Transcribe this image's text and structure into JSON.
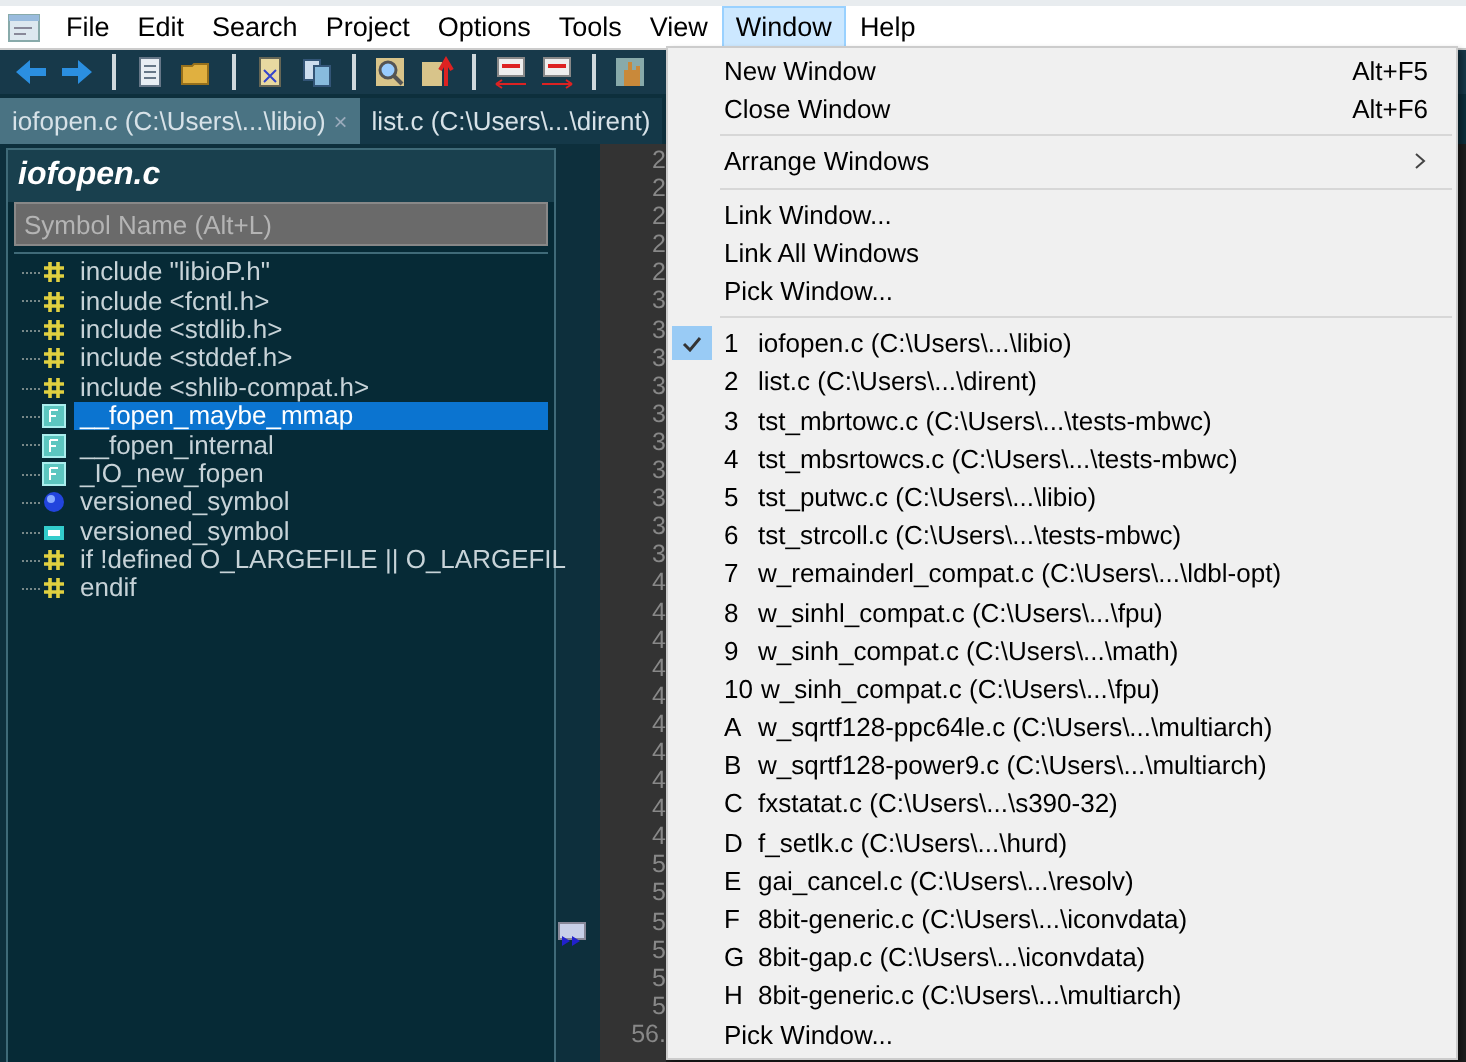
{
  "menubar": [
    {
      "label": "File",
      "selected": false
    },
    {
      "label": "Edit",
      "selected": false
    },
    {
      "label": "Search",
      "selected": false
    },
    {
      "label": "Project",
      "selected": false
    },
    {
      "label": "Options",
      "selected": false
    },
    {
      "label": "Tools",
      "selected": false
    },
    {
      "label": "View",
      "selected": false
    },
    {
      "label": "Window",
      "selected": true
    },
    {
      "label": "Help",
      "selected": false
    }
  ],
  "tabs": [
    {
      "label": "iofopen.c (C:\\Users\\...\\libio)",
      "selected": true,
      "close": "×"
    },
    {
      "label": "list.c (C:\\Users\\...\\dirent)",
      "selected": false
    }
  ],
  "symbol_panel": {
    "title": "iofopen.c",
    "search": {
      "placeholder": "Symbol Name (Alt+L)"
    },
    "items": [
      {
        "kind": "directive",
        "label": "include \"libioP.h\"",
        "selected": false
      },
      {
        "kind": "directive",
        "label": "include <fcntl.h>",
        "selected": false
      },
      {
        "kind": "directive",
        "label": "include <stdlib.h>",
        "selected": false
      },
      {
        "kind": "directive",
        "label": "include <stddef.h>",
        "selected": false
      },
      {
        "kind": "directive",
        "label": "include <shlib-compat.h>",
        "selected": false
      },
      {
        "kind": "function",
        "label": "__fopen_maybe_mmap",
        "selected": true
      },
      {
        "kind": "function",
        "label": "__fopen_internal",
        "selected": false
      },
      {
        "kind": "function",
        "label": "_IO_new_fopen",
        "selected": false
      },
      {
        "kind": "symbol",
        "label": "versioned_symbol",
        "selected": false
      },
      {
        "kind": "declaration",
        "label": "versioned_symbol",
        "selected": false
      },
      {
        "kind": "directive",
        "label": "if !defined O_LARGEFILE || O_LARGEFIL",
        "selected": false
      },
      {
        "kind": "directive",
        "label": "endif",
        "selected": false
      }
    ]
  },
  "gutter": {
    "line_numbers": [
      "2",
      "2",
      "2",
      "2",
      "2",
      "3",
      "3",
      "3",
      "3",
      "3",
      "3",
      "3",
      "3",
      "3",
      "3",
      "4",
      "4",
      "4",
      "4",
      "4",
      "4",
      "4",
      "4",
      "4",
      "4",
      "5",
      "5",
      "5",
      "5",
      "5",
      "5",
      "56."
    ]
  },
  "window_menu": {
    "items": [
      {
        "kind": "command",
        "label": "New Window",
        "shortcut": "Alt+F5"
      },
      {
        "kind": "command",
        "label": "Close Window",
        "shortcut": "Alt+F6"
      },
      {
        "kind": "separator"
      },
      {
        "kind": "submenu",
        "label": "Arrange Windows"
      },
      {
        "kind": "separator"
      },
      {
        "kind": "command",
        "label": "Link Window..."
      },
      {
        "kind": "command",
        "label": "Link All Windows"
      },
      {
        "kind": "command",
        "label": "Pick Window..."
      },
      {
        "kind": "separator"
      },
      {
        "kind": "window",
        "key": "1",
        "label": "iofopen.c (C:\\Users\\...\\libio)",
        "checked": true
      },
      {
        "kind": "window",
        "key": "2",
        "label": "list.c (C:\\Users\\...\\dirent)",
        "checked": false
      },
      {
        "kind": "window",
        "key": "3",
        "label": "tst_mbrtowc.c (C:\\Users\\...\\tests-mbwc)",
        "checked": false
      },
      {
        "kind": "window",
        "key": "4",
        "label": "tst_mbsrtowcs.c (C:\\Users\\...\\tests-mbwc)",
        "checked": false
      },
      {
        "kind": "window",
        "key": "5",
        "label": "tst_putwc.c (C:\\Users\\...\\libio)",
        "checked": false
      },
      {
        "kind": "window",
        "key": "6",
        "label": "tst_strcoll.c (C:\\Users\\...\\tests-mbwc)",
        "checked": false
      },
      {
        "kind": "window",
        "key": "7",
        "label": "w_remainderl_compat.c (C:\\Users\\...\\ldbl-opt)",
        "checked": false
      },
      {
        "kind": "window",
        "key": "8",
        "label": "w_sinhl_compat.c (C:\\Users\\...\\fpu)",
        "checked": false
      },
      {
        "kind": "window",
        "key": "9",
        "label": "w_sinh_compat.c (C:\\Users\\...\\math)",
        "checked": false
      },
      {
        "kind": "window",
        "key": "10",
        "label": "w_sinh_compat.c (C:\\Users\\...\\fpu)",
        "checked": false
      },
      {
        "kind": "window",
        "key": "A",
        "label": "w_sqrtf128-ppc64le.c (C:\\Users\\...\\multiarch)",
        "checked": false
      },
      {
        "kind": "window",
        "key": "B",
        "label": "w_sqrtf128-power9.c (C:\\Users\\...\\multiarch)",
        "checked": false
      },
      {
        "kind": "window",
        "key": "C",
        "label": "fxstatat.c (C:\\Users\\...\\s390-32)",
        "checked": false
      },
      {
        "kind": "window",
        "key": "D",
        "label": "f_setlk.c (C:\\Users\\...\\hurd)",
        "checked": false
      },
      {
        "kind": "window",
        "key": "E",
        "label": "gai_cancel.c (C:\\Users\\...\\resolv)",
        "checked": false
      },
      {
        "kind": "window",
        "key": "F",
        "label": "8bit-generic.c (C:\\Users\\...\\iconvdata)",
        "checked": false
      },
      {
        "kind": "window",
        "key": "G",
        "label": "8bit-gap.c (C:\\Users\\...\\iconvdata)",
        "checked": false
      },
      {
        "kind": "window",
        "key": "H",
        "label": "8bit-generic.c (C:\\Users\\...\\multiarch)",
        "checked": false
      },
      {
        "kind": "command",
        "label": "Pick Window..."
      }
    ]
  }
}
